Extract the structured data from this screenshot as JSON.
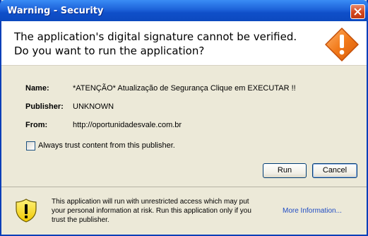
{
  "window": {
    "title": "Warning - Security"
  },
  "header": {
    "line1": "The application's digital signature cannot be verified.",
    "line2": "Do you want to run the application?",
    "icon": "warning-diamond-icon"
  },
  "details": {
    "name_label": "Name:",
    "name_value": "*ATENÇÃO* Atualização de Segurança Clique em EXECUTAR !!",
    "publisher_label": "Publisher:",
    "publisher_value": "UNKNOWN",
    "from_label": "From:",
    "from_value": "http://oportunidadesvale.com.br"
  },
  "trust": {
    "label": "Always trust content from this publisher.",
    "checked": false
  },
  "buttons": {
    "run": "Run",
    "cancel": "Cancel"
  },
  "footer": {
    "text": "This application will run with unrestricted access which may put your personal information at risk. Run this application only if you trust the publisher.",
    "link": "More Information...",
    "icon": "warning-shield-icon"
  },
  "colors": {
    "titlebar": "#0c49bf",
    "dialog_bg": "#ece9d8",
    "warning_orange": "#f27a1a",
    "link": "#1f4cc4"
  }
}
